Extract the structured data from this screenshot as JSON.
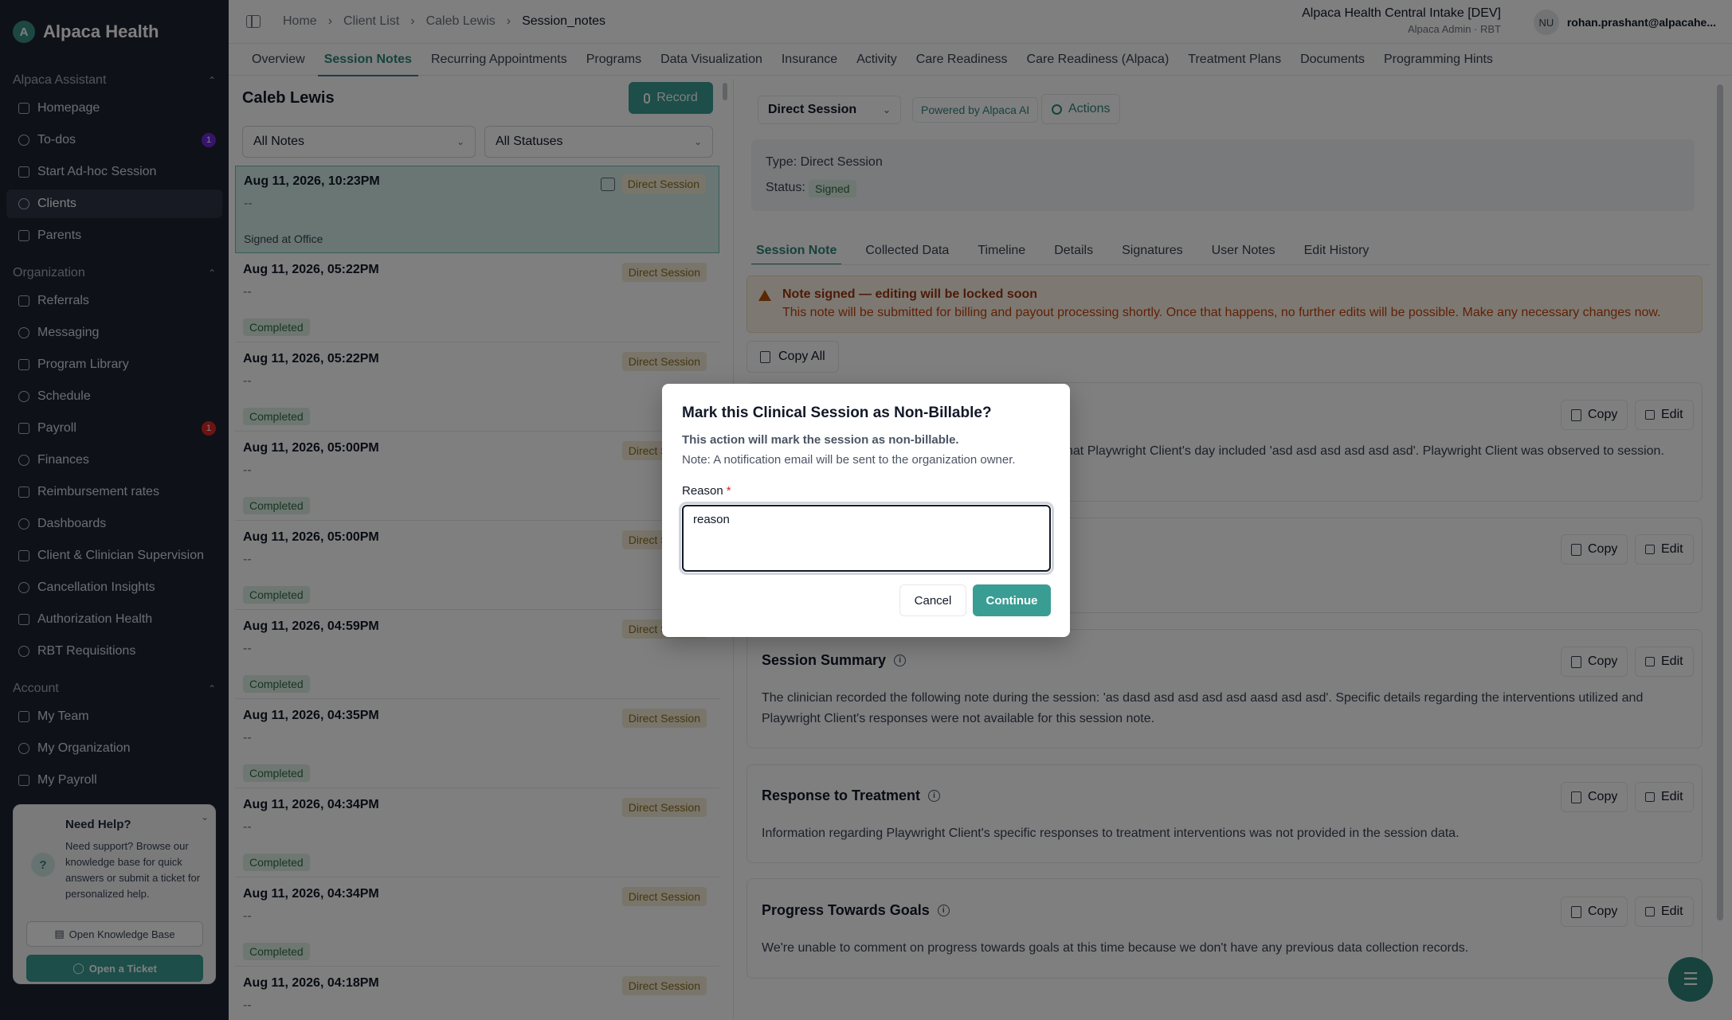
{
  "brand": {
    "name": "Alpaca Health",
    "logo_glyph": "A"
  },
  "sidebar": {
    "sections": [
      {
        "title": "Alpaca Assistant",
        "items": [
          {
            "label": "Homepage",
            "icon": "home-icon"
          },
          {
            "label": "To-dos",
            "icon": "todo-icon",
            "badge": "1",
            "badge_color": "#6d28d9"
          },
          {
            "label": "Start Ad-hoc Session",
            "icon": "mic-icon"
          },
          {
            "label": "Clients",
            "icon": "clients-icon",
            "active": true
          },
          {
            "label": "Parents",
            "icon": "parents-icon"
          }
        ]
      },
      {
        "title": "Organization",
        "items": [
          {
            "label": "Referrals",
            "icon": "referrals-icon"
          },
          {
            "label": "Messaging",
            "icon": "message-icon"
          },
          {
            "label": "Program Library",
            "icon": "library-icon"
          },
          {
            "label": "Schedule",
            "icon": "calendar-icon"
          },
          {
            "label": "Payroll",
            "icon": "payroll-icon",
            "badge": "1",
            "badge_color": "#dc2626"
          },
          {
            "label": "Finances",
            "icon": "finances-icon"
          },
          {
            "label": "Reimbursement rates",
            "icon": "rates-icon"
          },
          {
            "label": "Dashboards",
            "icon": "dashboard-icon"
          },
          {
            "label": "Client & Clinician Supervision",
            "icon": "shield-icon"
          },
          {
            "label": "Cancellation Insights",
            "icon": "chart-icon"
          },
          {
            "label": "Authorization Health",
            "icon": "heart-icon"
          },
          {
            "label": "RBT Requisitions",
            "icon": "requisition-icon"
          }
        ]
      },
      {
        "title": "Account",
        "items": [
          {
            "label": "My Team",
            "icon": "team-icon"
          },
          {
            "label": "My Organization",
            "icon": "organization-icon"
          },
          {
            "label": "My Payroll",
            "icon": "payroll-icon"
          }
        ]
      }
    ],
    "help": {
      "title": "Need Help?",
      "text": "Need support? Browse our knowledge base for quick answers or submit a ticket for personalized help.",
      "kb_button": "Open Knowledge Base",
      "ticket_button": "Open a Ticket"
    }
  },
  "header": {
    "breadcrumb": [
      "Home",
      "Client List",
      "Caleb Lewis",
      "Session_notes"
    ],
    "org_name": "Alpaca Health Central Intake [DEV]",
    "org_role": "Alpaca Admin · RBT",
    "user_initials": "NU",
    "user_email": "rohan.prashant@alpacahe..."
  },
  "tabs": [
    "Overview",
    "Session Notes",
    "Recurring Appointments",
    "Programs",
    "Data Visualization",
    "Insurance",
    "Activity",
    "Care Readiness",
    "Care Readiness (Alpaca)",
    "Treatment Plans",
    "Documents",
    "Programming Hints"
  ],
  "active_tab": "Session Notes",
  "notes_list": {
    "client_name": "Caleb Lewis",
    "record_label": "Record",
    "filter_notes": "All Notes",
    "filter_statuses": "All Statuses",
    "items": [
      {
        "date": "Aug 11, 2026, 10:23PM",
        "summary": "--",
        "type": "Direct Session",
        "status": "Signed at Office",
        "selected": true
      },
      {
        "date": "Aug 11, 2026, 05:22PM",
        "summary": "--",
        "type": "Direct Session",
        "status": "Completed"
      },
      {
        "date": "Aug 11, 2026, 05:22PM",
        "summary": "--",
        "type": "Direct Session",
        "status": "Completed"
      },
      {
        "date": "Aug 11, 2026, 05:00PM",
        "summary": "--",
        "type": "Direct Session",
        "status": "Completed"
      },
      {
        "date": "Aug 11, 2026, 05:00PM",
        "summary": "--",
        "type": "Direct Session",
        "status": "Completed"
      },
      {
        "date": "Aug 11, 2026, 04:59PM",
        "summary": "--",
        "type": "Direct Session",
        "status": "Completed"
      },
      {
        "date": "Aug 11, 2026, 04:35PM",
        "summary": "--",
        "type": "Direct Session",
        "status": "Completed"
      },
      {
        "date": "Aug 11, 2026, 04:34PM",
        "summary": "--",
        "type": "Direct Session",
        "status": "Completed"
      },
      {
        "date": "Aug 11, 2026, 04:34PM",
        "summary": "--",
        "type": "Direct Session",
        "status": "Completed"
      },
      {
        "date": "Aug 11, 2026, 04:18PM",
        "summary": "--",
        "type": "Direct Session",
        "status": ""
      }
    ]
  },
  "detail": {
    "session_type_select": "Direct Session",
    "powered_by": "Powered by Alpaca AI",
    "actions_label": "Actions",
    "type_line": "Type: Direct Session",
    "status_label": "Status:",
    "status_value": "Signed",
    "subtabs": [
      "Session Note",
      "Collected Data",
      "Timeline",
      "Details",
      "Signatures",
      "User Notes",
      "Edit History"
    ],
    "active_subtab": "Session Note",
    "warning_title": "Note signed — editing will be locked soon",
    "warning_text": "This note will be submitted for billing and payout processing shortly. Once that happens, no further edits will be possible. Make any necessary changes now.",
    "copy_all_label": "Copy All",
    "copy_label": "Copy",
    "edit_label": "Edit",
    "sections": [
      {
        "title": "",
        "body": "hat Playwright Client's day included 'asd asd asd asd asd asd'. Playwright Client was observed to session."
      },
      {
        "title": "",
        "body": ""
      },
      {
        "title": "Session Summary",
        "body": "The clinician recorded the following note during the session: 'as dasd asd asd asd asd aasd asd asd'. Specific details regarding the interventions utilized and Playwright Client's responses were not available for this session note."
      },
      {
        "title": "Response to Treatment",
        "body": "Information regarding Playwright Client's specific responses to treatment interventions was not provided in the session data."
      },
      {
        "title": "Progress Towards Goals",
        "body": "We're unable to comment on progress towards goals at this time because we don't have any previous data collection records."
      }
    ]
  },
  "modal": {
    "title": "Mark this Clinical Session as Non-Billable?",
    "subtitle": "This action will mark the session as non-billable.",
    "note": "Note: A notification email will be sent to the organization owner.",
    "reason_label": "Reason",
    "required_marker": "*",
    "reason_value": "reason",
    "cancel_label": "Cancel",
    "continue_label": "Continue"
  },
  "colors": {
    "accent": "#3a9d93",
    "sidebar_bg": "#1e2231",
    "warning_bg": "#fbf3e4",
    "status_green": "#dcefe3"
  }
}
